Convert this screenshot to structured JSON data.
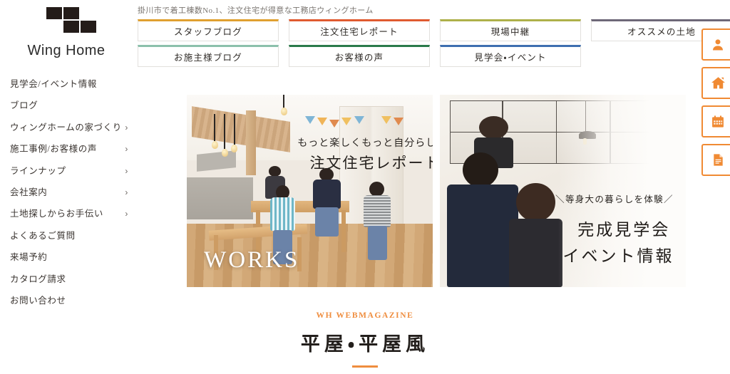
{
  "site": {
    "logo_text": "Wing Home",
    "logo_icon": "four-squares-logo",
    "tagline": "掛川市で着工棟数No.1、注文住宅が得意な工務店ウィングホーム"
  },
  "sidebar": {
    "items": [
      {
        "label": "見学会/イベント情報",
        "arrow": ""
      },
      {
        "label": "ブログ",
        "arrow": ""
      },
      {
        "label": "ウィングホームの家づくり",
        "arrow": "›"
      },
      {
        "label": "施工事例/お客様の声",
        "arrow": "›"
      },
      {
        "label": "ラインナップ",
        "arrow": "›"
      },
      {
        "label": "会社案内",
        "arrow": "›"
      },
      {
        "label": "土地探しからお手伝い",
        "arrow": "›"
      },
      {
        "label": "よくあるご質問",
        "arrow": ""
      },
      {
        "label": "来場予約",
        "arrow": ""
      },
      {
        "label": "カタログ請求",
        "arrow": ""
      },
      {
        "label": "お問い合わせ",
        "arrow": ""
      }
    ]
  },
  "topnav": {
    "rows": [
      [
        {
          "label": "スタッフブログ",
          "accent": "#e0a030"
        },
        {
          "label": "注文住宅レポート",
          "accent": "#e05a30"
        },
        {
          "label": "現場中継",
          "accent": "#aeb04a"
        },
        {
          "label": "オススメの土地",
          "accent": "#6e6878"
        }
      ],
      [
        {
          "label": "お施主様ブログ",
          "accent": "#8cc0ac"
        },
        {
          "label": "お客様の声",
          "accent": "#2a7a4a"
        },
        {
          "label": "見学会・イベント",
          "accent": "#3e6fb0"
        }
      ]
    ]
  },
  "iconbar": {
    "accent": "#f08a33",
    "buttons": [
      {
        "icon": "person-icon",
        "name": "visit-reservation"
      },
      {
        "icon": "house-icon",
        "name": "model-house"
      },
      {
        "icon": "calendar-icon",
        "name": "event-calendar"
      },
      {
        "icon": "document-icon",
        "name": "catalog-request"
      }
    ]
  },
  "hero": {
    "left": {
      "photo": "family-dining-kitchen-photo",
      "subtitle": "もっと楽しくもっと自分らしく",
      "title": "注文住宅レポート",
      "caption": "WORKS"
    },
    "right": {
      "photo": "family-father-baby-mother-photo",
      "subtitle": "＼等身大の暮らしを体験／",
      "title_line1": "完成見学会",
      "title_line2": "イベント情報"
    }
  },
  "magazine": {
    "kicker": "WH WEBMAGAZINE",
    "kicker_color": "#ef8d3e",
    "title": "平屋・平屋風",
    "rule_color": "#ef8d3e"
  }
}
